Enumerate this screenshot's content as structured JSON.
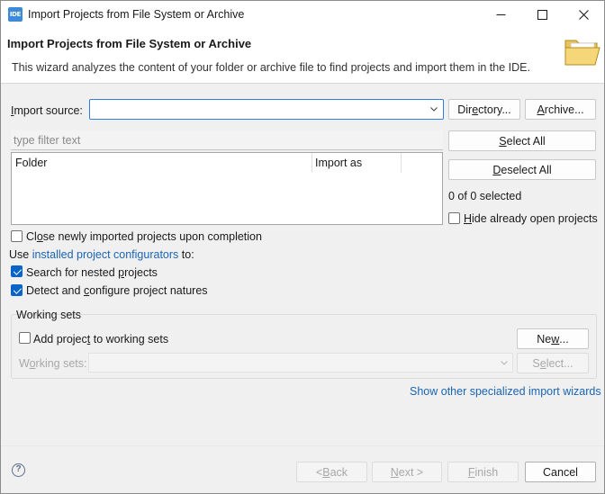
{
  "window": {
    "app_icon_text": "IDE",
    "title": "Import Projects from File System or Archive"
  },
  "header": {
    "title": "Import Projects from File System or Archive",
    "description": "This wizard analyzes the content of your folder or archive file to find projects and import them in the IDE."
  },
  "import_source": {
    "label_prefix": "I",
    "label_rest": "mport source:",
    "value": "",
    "directory_button": {
      "pre": "Dir",
      "mn": "e",
      "post": "ctory..."
    },
    "archive_button": {
      "pre": "",
      "mn": "A",
      "post": "rchive..."
    }
  },
  "filter": {
    "placeholder": "type filter text"
  },
  "table": {
    "columns": [
      "Folder",
      "Import as"
    ],
    "rows": []
  },
  "side": {
    "select_all": {
      "pre": "",
      "mn": "S",
      "post": "elect All"
    },
    "deselect_all": {
      "pre": "",
      "mn": "D",
      "post": "eselect All"
    },
    "selected_count": "0 of 0 selected",
    "hide_open": {
      "pre": "",
      "mn": "H",
      "post": "ide already open projects",
      "checked": false
    }
  },
  "options": {
    "close_newly": {
      "pre": "Cl",
      "mn": "o",
      "post": "se newly imported projects upon completion",
      "checked": false
    },
    "use_prefix": "Use ",
    "configurators_link": "installed project configurators",
    "use_suffix": " to:",
    "search_nested": {
      "pre": "Search for nested ",
      "mn": "p",
      "post": "rojects",
      "checked": true
    },
    "detect_configure": {
      "pre": "Detect and ",
      "mn": "c",
      "post": "onfigure project natures",
      "checked": true
    }
  },
  "working_sets": {
    "group_label": "Working sets",
    "add_checkbox": {
      "pre": "Add projec",
      "mn": "t",
      "post": " to working sets",
      "checked": false
    },
    "new_button": {
      "pre": "Ne",
      "mn": "w",
      "post": "..."
    },
    "combo_label": {
      "pre": "W",
      "mn": "o",
      "post": "rking sets:"
    },
    "select_button": {
      "pre": "S",
      "mn": "e",
      "post": "lect..."
    }
  },
  "other_wizards_link": "Show other specialized import wizards",
  "footer": {
    "help": "?",
    "back": {
      "pre": "< ",
      "mn": "B",
      "post": "ack"
    },
    "next": {
      "pre": "",
      "mn": "N",
      "post": "ext >"
    },
    "finish": {
      "pre": "",
      "mn": "F",
      "post": "inish"
    },
    "cancel": "Cancel"
  },
  "colors": {
    "accent": "#0a64c8",
    "link": "#1a64b4",
    "focus_border": "#2f7fd6"
  }
}
